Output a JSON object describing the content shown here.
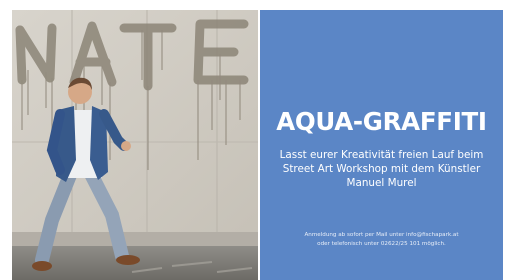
{
  "banner": {
    "title": "AQUA-GRAFFITI",
    "subtitle_lines": [
      "Lasst eurer Kreativität freien Lauf beim",
      "Street Art Workshop mit dem Künstler",
      "Manuel Murel"
    ],
    "footnote_lines": [
      "Anmeldung ab sofort per Mail unter info@fischapark.at",
      "oder telefonisch unter 02622/25 101 möglich."
    ]
  },
  "photo": {
    "graffiti_text": "NATE"
  },
  "colors": {
    "panel": "#5b86c6",
    "text": "#ffffff"
  }
}
